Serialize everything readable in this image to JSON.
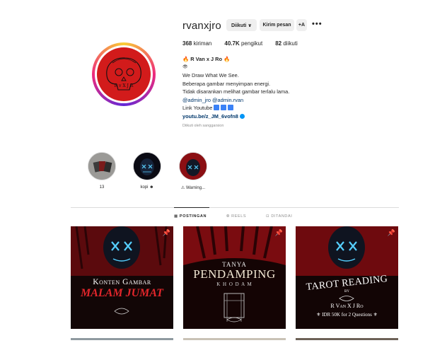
{
  "profile": {
    "username": "rvanxjro",
    "follow_button": "Diikuti ∨",
    "message_button": "Kirim pesan",
    "add_button": "+A",
    "more_button": "•••"
  },
  "stats": {
    "posts_count": "368",
    "posts_label": "kiriman",
    "followers_count": "40.7K",
    "followers_label": "pengikut",
    "following_count": "82",
    "following_label": "diikuti"
  },
  "bio": {
    "name": "R Van x J Ro",
    "line_eye": "👁",
    "line1": "We Draw What We See.",
    "line2": "Beberapa gambar menyimpan energi.",
    "line3": "Tidak disarankan melihat gambar terlalu lama.",
    "mentions": "@admin_jro @admin.rvan",
    "youtube_label": "Link Youtube",
    "youtube_url": "youtu.be/z_JM_6vofn8",
    "followed_by": "Diikuti oleh sanggarsion"
  },
  "highlights": [
    {
      "label": "13"
    },
    {
      "label": "kopi ☻"
    },
    {
      "label": "⚠ Warning..."
    }
  ],
  "tabs": {
    "posts": "▦ POSTINGAN",
    "reels": "⦾ REELS",
    "tagged": "⊡ DITANDAI"
  },
  "posts": [
    {
      "line1": "Konten Gambar",
      "line2": "MALAM JUMAT",
      "pin": "📌"
    },
    {
      "line1": "TANYA",
      "line2": "PENDAMPING",
      "line3": "K H O D A M",
      "pin": "📌"
    },
    {
      "line1": "TAROT READING",
      "line2": "BY",
      "line3": "R Van X J Ro",
      "line4": "⚜ IDR 50K for 2 Questions ⚜",
      "pin": "📌"
    }
  ],
  "colors": {
    "avatar_red": "#d21b1b",
    "poster_red": "#c0161b",
    "link_blue": "#00376b"
  }
}
